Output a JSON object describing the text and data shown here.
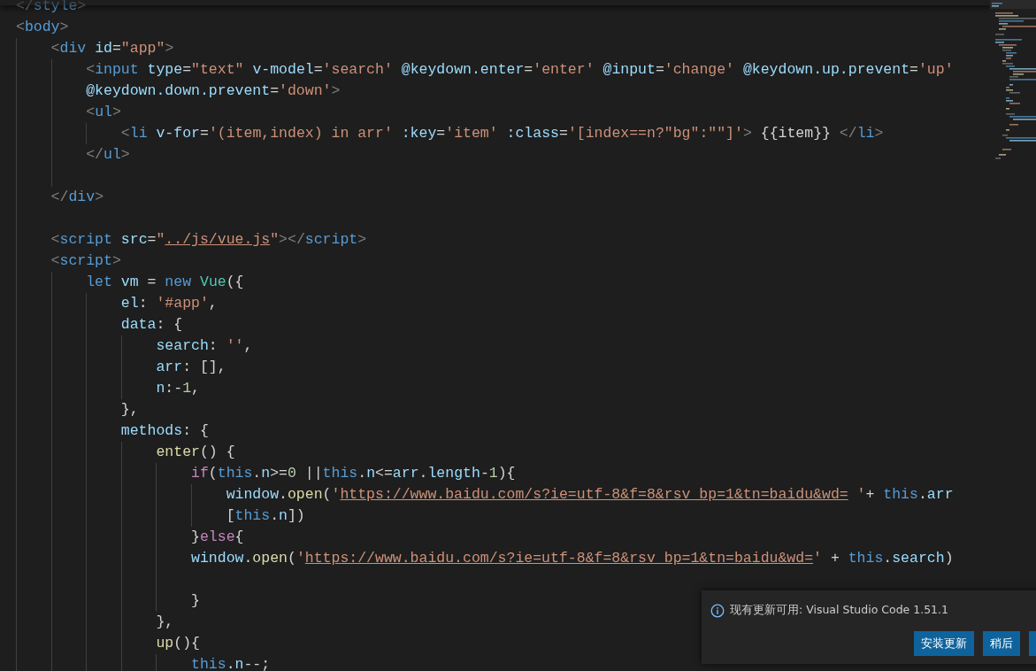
{
  "editor": {
    "lines": [
      {
        "kind": "code",
        "tokens": [
          {
            "kind": "br",
            "s": "</"
          },
          {
            "kind": "tag",
            "s": "style"
          },
          {
            "kind": "br",
            "s": ">"
          }
        ]
      },
      {
        "kind": "code",
        "tokens": [
          {
            "kind": "br",
            "s": "<"
          },
          {
            "kind": "tag",
            "s": "body"
          },
          {
            "kind": "br",
            "s": ">"
          }
        ]
      },
      {
        "kind": "code",
        "tokens": [
          {
            "kind": "br",
            "s": "    <"
          },
          {
            "kind": "tag",
            "s": "div"
          },
          {
            "kind": "attr",
            "s": " id"
          },
          {
            "kind": "p",
            "s": "="
          },
          {
            "kind": "str",
            "s": "\"app\""
          },
          {
            "kind": "br",
            "s": ">"
          }
        ]
      },
      {
        "kind": "code",
        "tokens": [
          {
            "kind": "br",
            "s": "        <"
          },
          {
            "kind": "tag",
            "s": "input"
          },
          {
            "kind": "attr",
            "s": " type"
          },
          {
            "kind": "p",
            "s": "="
          },
          {
            "kind": "str",
            "s": "\"text\""
          },
          {
            "kind": "attr",
            "s": " v-model"
          },
          {
            "kind": "p",
            "s": "="
          },
          {
            "kind": "str",
            "s": "'search'"
          },
          {
            "kind": "attr",
            "s": " @keydown.enter"
          },
          {
            "kind": "p",
            "s": "="
          },
          {
            "kind": "str",
            "s": "'enter'"
          },
          {
            "kind": "attr",
            "s": " @input"
          },
          {
            "kind": "p",
            "s": "="
          },
          {
            "kind": "str",
            "s": "'change'"
          },
          {
            "kind": "attr",
            "s": " @keydown.up.prevent"
          },
          {
            "kind": "p",
            "s": "="
          },
          {
            "kind": "str",
            "s": "'up'"
          }
        ]
      },
      {
        "kind": "code",
        "tokens": [
          {
            "kind": "attr",
            "s": "        @keydown.down.prevent"
          },
          {
            "kind": "p",
            "s": "="
          },
          {
            "kind": "str",
            "s": "'down'"
          },
          {
            "kind": "br",
            "s": ">"
          }
        ]
      },
      {
        "kind": "code",
        "tokens": [
          {
            "kind": "br",
            "s": "        <"
          },
          {
            "kind": "tag",
            "s": "ul"
          },
          {
            "kind": "br",
            "s": ">"
          }
        ]
      },
      {
        "kind": "code",
        "tokens": [
          {
            "kind": "br",
            "s": "            <"
          },
          {
            "kind": "tag",
            "s": "li"
          },
          {
            "kind": "attr",
            "s": " v-for"
          },
          {
            "kind": "p",
            "s": "="
          },
          {
            "kind": "str",
            "s": "'(item,index) in arr'"
          },
          {
            "kind": "attr",
            "s": " :key"
          },
          {
            "kind": "p",
            "s": "="
          },
          {
            "kind": "str",
            "s": "'item'"
          },
          {
            "kind": "attr",
            "s": " :class"
          },
          {
            "kind": "p",
            "s": "="
          },
          {
            "kind": "str",
            "s": "'[index==n?\"bg\":\"\"]'"
          },
          {
            "kind": "br",
            "s": ">"
          },
          {
            "kind": "p",
            "s": " {{item}} "
          },
          {
            "kind": "br",
            "s": "</"
          },
          {
            "kind": "tag",
            "s": "li"
          },
          {
            "kind": "br",
            "s": ">"
          }
        ]
      },
      {
        "kind": "code",
        "tokens": [
          {
            "kind": "br",
            "s": "        </"
          },
          {
            "kind": "tag",
            "s": "ul"
          },
          {
            "kind": "br",
            "s": ">"
          }
        ]
      },
      {
        "kind": "blank"
      },
      {
        "kind": "code",
        "tokens": [
          {
            "kind": "br",
            "s": "    </"
          },
          {
            "kind": "tag",
            "s": "div"
          },
          {
            "kind": "br",
            "s": ">"
          }
        ]
      },
      {
        "kind": "blank"
      },
      {
        "kind": "code",
        "tokens": [
          {
            "kind": "br",
            "s": "    <"
          },
          {
            "kind": "tag",
            "s": "script"
          },
          {
            "kind": "attr",
            "s": " src"
          },
          {
            "kind": "p",
            "s": "="
          },
          {
            "kind": "str",
            "s": "\""
          },
          {
            "kind": "link",
            "s": "../js/vue.js"
          },
          {
            "kind": "str",
            "s": "\""
          },
          {
            "kind": "br",
            "s": "></"
          },
          {
            "kind": "tag",
            "s": "script"
          },
          {
            "kind": "br",
            "s": ">"
          }
        ]
      },
      {
        "kind": "code",
        "tokens": [
          {
            "kind": "br",
            "s": "    <"
          },
          {
            "kind": "tag",
            "s": "script"
          },
          {
            "kind": "br",
            "s": ">"
          }
        ]
      },
      {
        "kind": "code",
        "tokens": [
          {
            "kind": "kw",
            "s": "        let"
          },
          {
            "kind": "var",
            "s": " vm"
          },
          {
            "kind": "p",
            "s": " = "
          },
          {
            "kind": "kw",
            "s": "new"
          },
          {
            "kind": "cls",
            "s": " Vue"
          },
          {
            "kind": "p",
            "s": "({"
          }
        ]
      },
      {
        "kind": "code",
        "tokens": [
          {
            "kind": "var",
            "s": "            el"
          },
          {
            "kind": "p",
            "s": ": "
          },
          {
            "kind": "str",
            "s": "'#app'"
          },
          {
            "kind": "p",
            "s": ","
          }
        ]
      },
      {
        "kind": "code",
        "tokens": [
          {
            "kind": "var",
            "s": "            data"
          },
          {
            "kind": "p",
            "s": ": {"
          }
        ]
      },
      {
        "kind": "code",
        "tokens": [
          {
            "kind": "var",
            "s": "                search"
          },
          {
            "kind": "p",
            "s": ": "
          },
          {
            "kind": "str",
            "s": "''"
          },
          {
            "kind": "p",
            "s": ","
          }
        ]
      },
      {
        "kind": "code",
        "tokens": [
          {
            "kind": "var",
            "s": "                arr"
          },
          {
            "kind": "p",
            "s": ": [],"
          }
        ]
      },
      {
        "kind": "code",
        "tokens": [
          {
            "kind": "var",
            "s": "                n"
          },
          {
            "kind": "p",
            "s": ":-"
          },
          {
            "kind": "num",
            "s": "1"
          },
          {
            "kind": "p",
            "s": ","
          }
        ]
      },
      {
        "kind": "code",
        "tokens": [
          {
            "kind": "p",
            "s": "            },"
          }
        ]
      },
      {
        "kind": "code",
        "tokens": [
          {
            "kind": "var",
            "s": "            methods"
          },
          {
            "kind": "p",
            "s": ": {"
          }
        ]
      },
      {
        "kind": "code",
        "tokens": [
          {
            "kind": "fn",
            "s": "                enter"
          },
          {
            "kind": "p",
            "s": "() {"
          }
        ]
      },
      {
        "kind": "code",
        "tokens": [
          {
            "kind": "ctl",
            "s": "                    if"
          },
          {
            "kind": "p",
            "s": "("
          },
          {
            "kind": "kw",
            "s": "this"
          },
          {
            "kind": "p",
            "s": "."
          },
          {
            "kind": "var",
            "s": "n"
          },
          {
            "kind": "p",
            "s": ">="
          },
          {
            "kind": "num",
            "s": "0"
          },
          {
            "kind": "p",
            "s": " ||"
          },
          {
            "kind": "kw",
            "s": "this"
          },
          {
            "kind": "p",
            "s": "."
          },
          {
            "kind": "var",
            "s": "n"
          },
          {
            "kind": "p",
            "s": "<="
          },
          {
            "kind": "var",
            "s": "arr"
          },
          {
            "kind": "p",
            "s": "."
          },
          {
            "kind": "var",
            "s": "length"
          },
          {
            "kind": "p",
            "s": "-"
          },
          {
            "kind": "num",
            "s": "1"
          },
          {
            "kind": "p",
            "s": "){"
          }
        ]
      },
      {
        "kind": "code",
        "tokens": [
          {
            "kind": "var",
            "s": "                        window"
          },
          {
            "kind": "p",
            "s": "."
          },
          {
            "kind": "fn",
            "s": "open"
          },
          {
            "kind": "p",
            "s": "("
          },
          {
            "kind": "str",
            "s": "'"
          },
          {
            "kind": "link",
            "s": "https://www.baidu.com/s?ie=utf-8&f=8&rsv_bp=1&tn=baidu&wd="
          },
          {
            "kind": "str",
            "s": " '"
          },
          {
            "kind": "p",
            "s": "+ "
          },
          {
            "kind": "kw",
            "s": "this"
          },
          {
            "kind": "p",
            "s": "."
          },
          {
            "kind": "var",
            "s": "arr"
          }
        ]
      },
      {
        "kind": "code",
        "tokens": [
          {
            "kind": "p",
            "s": "                        ["
          },
          {
            "kind": "kw",
            "s": "this"
          },
          {
            "kind": "p",
            "s": "."
          },
          {
            "kind": "var",
            "s": "n"
          },
          {
            "kind": "p",
            "s": "])"
          }
        ]
      },
      {
        "kind": "code",
        "tokens": [
          {
            "kind": "p",
            "s": "                    }"
          },
          {
            "kind": "ctl",
            "s": "else"
          },
          {
            "kind": "p",
            "s": "{"
          }
        ]
      },
      {
        "kind": "code",
        "tokens": [
          {
            "kind": "var",
            "s": "                    window"
          },
          {
            "kind": "p",
            "s": "."
          },
          {
            "kind": "fn",
            "s": "open"
          },
          {
            "kind": "p",
            "s": "("
          },
          {
            "kind": "str",
            "s": "'"
          },
          {
            "kind": "link",
            "s": "https://www.baidu.com/s?ie=utf-8&f=8&rsv_bp=1&tn=baidu&wd="
          },
          {
            "kind": "str",
            "s": "'"
          },
          {
            "kind": "p",
            "s": " + "
          },
          {
            "kind": "kw",
            "s": "this"
          },
          {
            "kind": "p",
            "s": "."
          },
          {
            "kind": "var",
            "s": "search"
          },
          {
            "kind": "p",
            "s": ")"
          }
        ]
      },
      {
        "kind": "blank"
      },
      {
        "kind": "code",
        "tokens": [
          {
            "kind": "p",
            "s": "                    }"
          }
        ]
      },
      {
        "kind": "code",
        "tokens": [
          {
            "kind": "p",
            "s": "                },"
          }
        ]
      },
      {
        "kind": "code",
        "tokens": [
          {
            "kind": "fn",
            "s": "                up"
          },
          {
            "kind": "p",
            "s": "(){"
          }
        ]
      },
      {
        "kind": "code",
        "tokens": [
          {
            "kind": "kw",
            "s": "                    this"
          },
          {
            "kind": "p",
            "s": "."
          },
          {
            "kind": "var",
            "s": "n"
          },
          {
            "kind": "p",
            "s": "--;"
          }
        ]
      }
    ]
  },
  "notification": {
    "message": "现有更新可用: Visual Studio Code 1.51.1",
    "buttons": [
      {
        "kind": "button",
        "label": "安装更新"
      },
      {
        "kind": "button",
        "label": "稍后"
      },
      {
        "kind": "button"
      }
    ]
  }
}
